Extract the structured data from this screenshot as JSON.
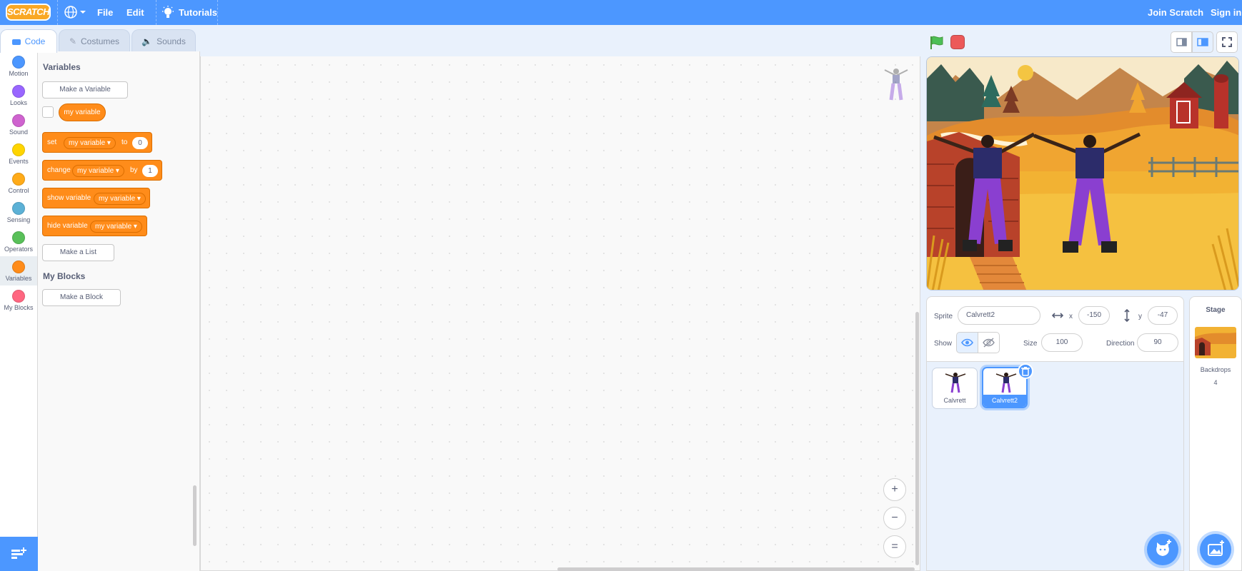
{
  "menubar": {
    "logo": "SCRATCH",
    "file": "File",
    "edit": "Edit",
    "tutorials": "Tutorials",
    "join": "Join Scratch",
    "signin": "Sign in"
  },
  "tabs": {
    "code": "Code",
    "costumes": "Costumes",
    "sounds": "Sounds"
  },
  "categories": [
    {
      "label": "Motion",
      "color": "#4c97ff"
    },
    {
      "label": "Looks",
      "color": "#9966ff"
    },
    {
      "label": "Sound",
      "color": "#cf63cf"
    },
    {
      "label": "Events",
      "color": "#ffbf00"
    },
    {
      "label": "Control",
      "color": "#ffab19"
    },
    {
      "label": "Sensing",
      "color": "#5cb1d6"
    },
    {
      "label": "Operators",
      "color": "#59c059"
    },
    {
      "label": "Variables",
      "color": "#ff8c1a"
    },
    {
      "label": "My Blocks",
      "color": "#ff6680"
    }
  ],
  "palette": {
    "variables_title": "Variables",
    "make_variable": "Make a Variable",
    "variable_name": "my variable",
    "set_block": {
      "kw": "set",
      "var": "my variable",
      "to": "to",
      "value": "0"
    },
    "change_block": {
      "kw": "change",
      "var": "my variable",
      "by": "by",
      "value": "1"
    },
    "show_block": {
      "kw": "show variable",
      "var": "my variable"
    },
    "hide_block": {
      "kw": "hide variable",
      "var": "my variable"
    },
    "make_list": "Make a List",
    "myblocks_title": "My Blocks",
    "make_block": "Make a Block"
  },
  "zoom": {
    "in": "+",
    "out": "−",
    "reset": "="
  },
  "sprite_info": {
    "sprite_label": "Sprite",
    "sprite_name": "Calvrett2",
    "x_label": "x",
    "x_value": "-150",
    "y_label": "y",
    "y_value": "-47",
    "show_label": "Show",
    "size_label": "Size",
    "size_value": "100",
    "direction_label": "Direction",
    "direction_value": "90"
  },
  "sprites": [
    {
      "name": "Calvrett",
      "selected": false
    },
    {
      "name": "Calvrett2",
      "selected": true
    }
  ],
  "stage_panel": {
    "title": "Stage",
    "backdrops_label": "Backdrops",
    "backdrops_count": "4"
  }
}
